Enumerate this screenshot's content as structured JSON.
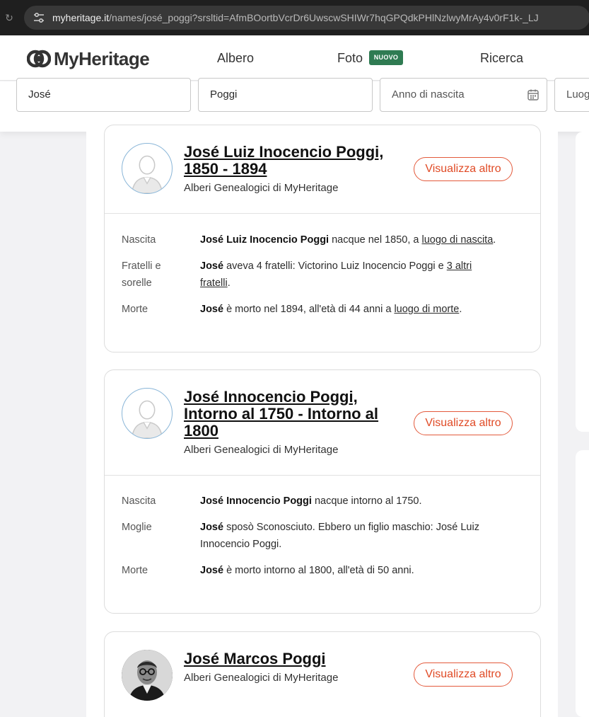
{
  "browser": {
    "url_host": "myheritage.it",
    "url_path": "/names/josé_poggi?srsltid=AfmBOortbVcrDr6UwscwSHIWr7hqGPQdkPHlNzlwyMrAy4v0rF1k-_LJ"
  },
  "header": {
    "logo_text": "MyHeritage",
    "nav": {
      "albero": "Albero",
      "foto": "Foto",
      "foto_badge": "NUOVO",
      "ricerca": "Ricerca"
    }
  },
  "search": {
    "first_name": "José",
    "last_name": "Poggi",
    "birth_year_placeholder": "Anno di nascita",
    "place_placeholder": "Luog"
  },
  "results": [
    {
      "name_line1": "José Luiz Inocencio Poggi,",
      "name_line2": "1850 - 1894",
      "source": "Alberi Genealogici di MyHeritage",
      "button": "Visualizza altro",
      "facts": [
        {
          "label": "Nascita",
          "bold": "José Luiz Inocencio Poggi",
          "text": " nacque nel 1850, a ",
          "link": "luogo di nascita",
          "end": "."
        },
        {
          "label_line1": "Fratelli e",
          "label_line2": "sorelle",
          "bold": "José",
          "text": " aveva 4 fratelli: Victorino Luiz Inocencio Poggi e ",
          "link_a": "3 altri",
          "link_b": "fratelli",
          "end": "."
        },
        {
          "label": "Morte",
          "bold": "José",
          "text": " è morto nel 1894, all'età di 44 anni a ",
          "link": "luogo di morte",
          "end": "."
        }
      ]
    },
    {
      "name_line1": "José Innocencio Poggi,",
      "name_line2": "Intorno al 1750 - Intorno al",
      "name_line3": "1800",
      "source": "Alberi Genealogici di MyHeritage",
      "button": "Visualizza altro",
      "facts": [
        {
          "label": "Nascita",
          "bold": "José Innocencio Poggi",
          "text": " nacque intorno al 1750."
        },
        {
          "label": "Moglie",
          "bold": "José",
          "text_line1": " sposò Sconosciuto. Ebbero un figlio maschio: José Luiz",
          "text_line2": "Innocencio Poggi."
        },
        {
          "label": "Morte",
          "bold": "José",
          "text": " è morto intorno al 1800, all'età di 50 anni."
        }
      ]
    },
    {
      "name_line1": "José Marcos Poggi",
      "source": "Alberi Genealogici di MyHeritage",
      "button": "Visualizza altro"
    }
  ],
  "colors": {
    "accent": "#e04a25",
    "badge": "#2f7b52",
    "avatar_border": "#8ab6d8"
  }
}
